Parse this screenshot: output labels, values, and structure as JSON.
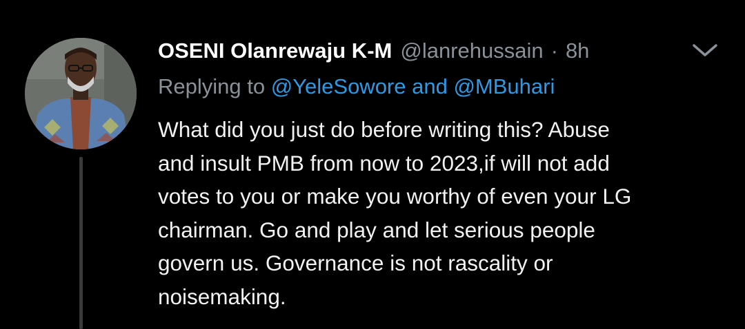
{
  "tweet": {
    "display_name": "OSENI Olanrewaju K-M",
    "handle": "@lanrehussain",
    "separator": "·",
    "time": "8h",
    "replying_prefix": "Replying to",
    "reply_targets": "@YeleSowore and @MBuhari",
    "body_lines": [
      "What did you just do before writing this? Abuse",
      "and insult PMB from now to 2023,if will not add",
      "votes to you or make you worthy of even your LG",
      "chairman. Go and play and let serious people",
      "govern us. Governance is not rascality or",
      "noisemaking."
    ]
  },
  "icons": {
    "avatar": "profile-photo",
    "menu": "chevron-down-icon"
  },
  "colors": {
    "background": "#000000",
    "primary_text": "#ffffff",
    "secondary_text": "#8a9299",
    "link": "#2a9be8",
    "thread_line": "#3a3a3a"
  }
}
